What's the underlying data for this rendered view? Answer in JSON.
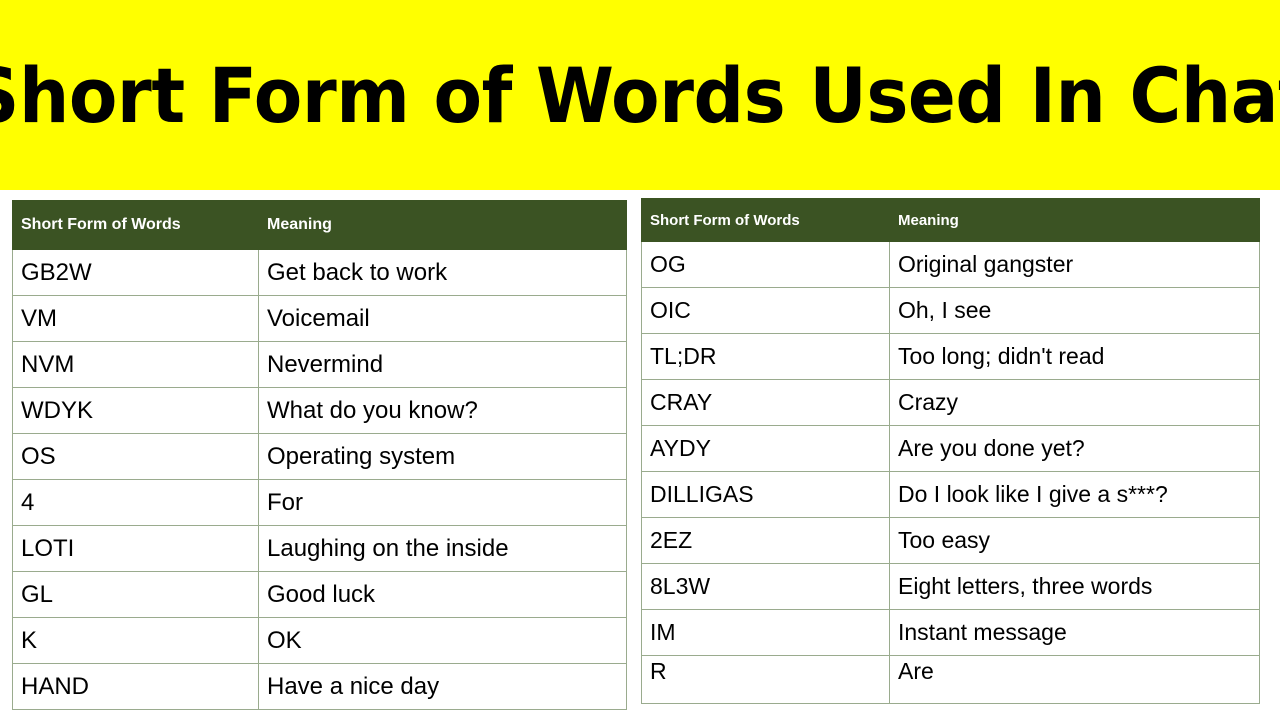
{
  "banner": {
    "title": "Short Form of Words Used In Chat",
    "background_color": "#ffff00",
    "text_color": "#000000"
  },
  "colors": {
    "header_green": "#3b5323",
    "gridline": "#9aab8e",
    "page_background": "#ffffff",
    "body_text": "#000000",
    "header_text": "#ffffff"
  },
  "tables": [
    {
      "id": "left",
      "columns": [
        "Short Form of Words",
        "Meaning"
      ],
      "rows": [
        [
          "GB2W",
          "Get back to work"
        ],
        [
          "VM",
          "Voicemail"
        ],
        [
          "NVM",
          "Nevermind"
        ],
        [
          "WDYK",
          "What do you know?"
        ],
        [
          "OS",
          "Operating system"
        ],
        [
          "4",
          "For"
        ],
        [
          "LOTI",
          "Laughing on the inside"
        ],
        [
          "GL",
          "Good luck"
        ],
        [
          "K",
          "OK"
        ],
        [
          "HAND",
          "Have a nice day"
        ]
      ]
    },
    {
      "id": "right",
      "columns": [
        "Short Form of Words",
        "Meaning"
      ],
      "rows": [
        [
          "OG",
          "Original gangster"
        ],
        [
          "OIC",
          "Oh, I see"
        ],
        [
          "TL;DR",
          "Too long; didn't read"
        ],
        [
          "CRAY",
          "Crazy"
        ],
        [
          "AYDY",
          "Are you done yet?"
        ],
        [
          "DILLIGAS",
          "Do I look like I give a s***?"
        ],
        [
          "2EZ",
          "Too easy"
        ],
        [
          "8L3W",
          "Eight letters, three words"
        ],
        [
          "IM",
          "Instant message"
        ],
        [
          "R",
          "Are"
        ]
      ]
    }
  ]
}
